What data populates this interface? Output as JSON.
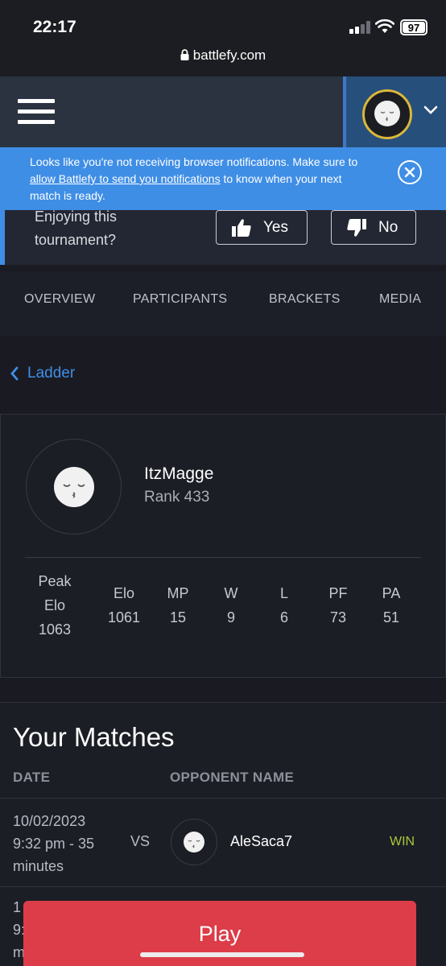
{
  "status_bar": {
    "time": "22:17",
    "battery": "97",
    "url": "battlefy.com"
  },
  "header": {
    "menu_icon": "hamburger-icon",
    "profile_icon": "kiss-face-icon",
    "dropdown_icon": "chevron-down-icon"
  },
  "notification": {
    "text_before": "Looks like you're not receiving browser notifications. Make sure to ",
    "link": "allow Battlefy to send you notifications",
    "text_after": " to know when your next match is ready.",
    "close_icon": "close-circle-icon"
  },
  "feedback": {
    "question": "Enjoying this tournament?",
    "yes_label": "Yes",
    "no_label": "No"
  },
  "tabs": [
    {
      "label": "OVERVIEW"
    },
    {
      "label": "PARTICIPANTS"
    },
    {
      "label": "BRACKETS"
    },
    {
      "label": "MEDIA"
    }
  ],
  "breadcrumb": {
    "back_label": "Ladder"
  },
  "player": {
    "name": "ItzMagge",
    "rank": "Rank 433",
    "stats": [
      {
        "label_1": "Peak",
        "label_2": "Elo",
        "value": "1063"
      },
      {
        "label": "Elo",
        "value": "1061"
      },
      {
        "label": "MP",
        "value": "15"
      },
      {
        "label": "W",
        "value": "9"
      },
      {
        "label": "L",
        "value": "6"
      },
      {
        "label": "PF",
        "value": "73"
      },
      {
        "label": "PA",
        "value": "51"
      }
    ]
  },
  "matches": {
    "title": "Your Matches",
    "col_date": "DATE",
    "col_opponent": "OPPONENT NAME",
    "rows": [
      {
        "date": "10/02/2023",
        "time": "9:32 pm - 35",
        "duration_unit": "minutes",
        "vs": "VS",
        "opponent": "AleSaca7",
        "result": "WIN"
      },
      {
        "date_partial": "1",
        "time_partial": "9:",
        "unit_partial": "m"
      }
    ]
  },
  "play_button": {
    "label": "Play"
  },
  "colors": {
    "accent_blue": "#3f8ee6",
    "play_red": "#dc3d48",
    "win_green": "#a6c93a",
    "avatar_ring_gold": "#d9b73a"
  }
}
